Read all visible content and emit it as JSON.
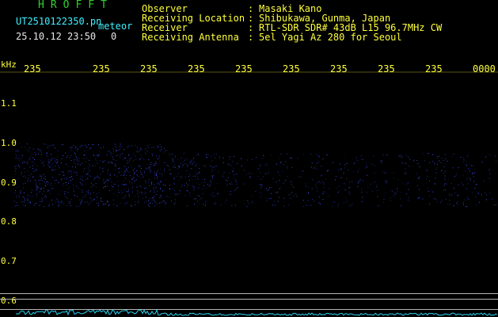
{
  "header": {
    "brand": "HROFFT",
    "file_name": "UT2510122350.pn",
    "tag": "meteor",
    "datetime": "25.10.12 23:50",
    "frame": "0",
    "observer_label": "Observer",
    "observer_value": "Masaki Kano",
    "location_label": "Receiving Location",
    "location_value": "Shibukawa, Gunma, Japan",
    "receiver_label": "Receiver",
    "receiver_value": "RTL-SDR SDR# 43dB L15 96.7MHz CW",
    "antenna_label": "Receiving Antenna",
    "antenna_value": "5el Yagi Az 280 for Seoul",
    "separator": ":"
  },
  "spectrogram": {
    "y_unit": "kHz",
    "y_ticks": [
      "1.1",
      "1.0",
      "0.9",
      "0.8",
      "0.7",
      "0.6"
    ],
    "time_ticks": [
      "235",
      "235",
      "235",
      "235",
      "235",
      "235",
      "235",
      "235",
      "235",
      "0000"
    ],
    "echo_band_khz": [
      0.84,
      1.0
    ],
    "colors": {
      "background": "#000000",
      "axis_text": "#ffff3c",
      "echo": "#3c50ff",
      "grid_lines": "#b4b4b4",
      "level_trace": "#28d2f0"
    }
  }
}
